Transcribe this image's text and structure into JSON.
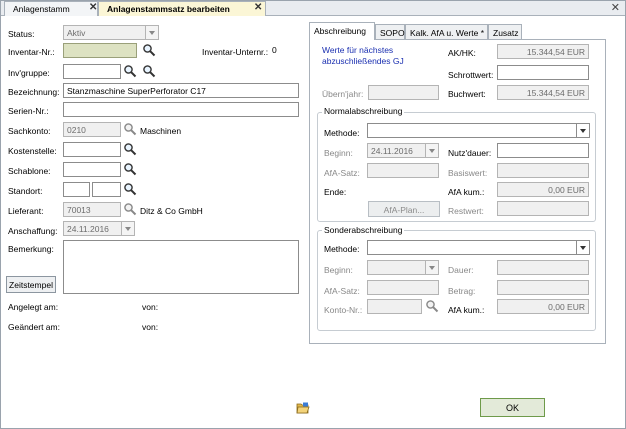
{
  "tabs": [
    {
      "label": "Anlagenstamm",
      "active": false
    },
    {
      "label": "Anlagenstammsatz bearbeiten",
      "active": true
    }
  ],
  "left": {
    "status": {
      "label": "Status:",
      "value": "Aktiv"
    },
    "inventar_nr": {
      "label": "Inventar-Nr.:",
      "value": ""
    },
    "inventar_unternr": {
      "label": "Inventar-Unternr.:",
      "value": "0"
    },
    "inv_gruppe": {
      "label": "Inv'gruppe:",
      "value": ""
    },
    "bezeichnung": {
      "label": "Bezeichnung:",
      "value": "Stanzmaschine SuperPerforator C17"
    },
    "serien_nr": {
      "label": "Serien-Nr.:",
      "value": ""
    },
    "sachkonto": {
      "label": "Sachkonto:",
      "value": "0210",
      "desc": "Maschinen"
    },
    "kostenstelle": {
      "label": "Kostenstelle:",
      "value": ""
    },
    "schablone": {
      "label": "Schablone:",
      "value": ""
    },
    "standort": {
      "label": "Standort:",
      "value1": "",
      "value2": ""
    },
    "lieferant": {
      "label": "Lieferant:",
      "value": "70013",
      "desc": "Ditz & Co GmbH"
    },
    "anschaffung": {
      "label": "Anschaffung:",
      "value": "24.11.2016"
    },
    "bemerkung": {
      "label": "Bemerkung:",
      "value": ""
    },
    "zeitstempel_button": "Zeitstempel",
    "angelegt": {
      "label": "Angelegt am:",
      "von_label": "von:"
    },
    "geaendert": {
      "label": "Geändert am:",
      "von_label": "von:"
    }
  },
  "right_tabs": [
    {
      "label": "Abschreibung",
      "active": true
    },
    {
      "label": "SOPO",
      "active": false
    },
    {
      "label": "Kalk. AfA u. Werte *",
      "active": false
    },
    {
      "label": "Zusatz",
      "active": false
    }
  ],
  "abschreibung": {
    "hint": "Werte für nächstes abzuschließendes GJ",
    "ak_hk": {
      "label": "AK/HK:",
      "value": "15.344,54 EUR"
    },
    "schrottwert": {
      "label": "Schrottwert:",
      "value": ""
    },
    "uebern_jahr": {
      "label": "Übern'jahr:",
      "value": ""
    },
    "buchwert": {
      "label": "Buchwert:",
      "value": "15.344,54 EUR"
    },
    "normal": {
      "title": "Normalabschreibung",
      "methode": {
        "label": "Methode:",
        "value": ""
      },
      "beginn": {
        "label": "Beginn:",
        "value": "24.11.2016"
      },
      "nutzdauer": {
        "label": "Nutz'dauer:",
        "value": ""
      },
      "afa_satz": {
        "label": "AfA-Satz:",
        "value": ""
      },
      "basiswert": {
        "label": "Basiswert:",
        "value": ""
      },
      "ende": {
        "label": "Ende:"
      },
      "afa_kum": {
        "label": "AfA kum.:",
        "value": "0,00 EUR"
      },
      "afa_plan_button": "AfA-Plan...",
      "restwert": {
        "label": "Restwert:",
        "value": ""
      }
    },
    "sonder": {
      "title": "Sonderabschreibung",
      "methode": {
        "label": "Methode:",
        "value": ""
      },
      "beginn": {
        "label": "Beginn:",
        "value": ""
      },
      "dauer": {
        "label": "Dauer:",
        "value": ""
      },
      "afa_satz": {
        "label": "AfA-Satz:",
        "value": ""
      },
      "betrag": {
        "label": "Betrag:",
        "value": ""
      },
      "konto_nr": {
        "label": "Konto-Nr.:",
        "value": ""
      },
      "afa_kum": {
        "label": "AfA kum.:",
        "value": "0,00 EUR"
      }
    }
  },
  "footer": {
    "ok_button": "OK",
    "folder_icon": "open-folder-icon"
  },
  "colors": {
    "active_tab": "#fbf6d6",
    "required_field": "#dde2c2",
    "hint_text": "#1a2fb0",
    "ok_button_border": "#6e9a4a"
  },
  "icons": {
    "search": "magnifier-icon",
    "close": "close-icon",
    "dropdown": "chevron-down-icon"
  }
}
